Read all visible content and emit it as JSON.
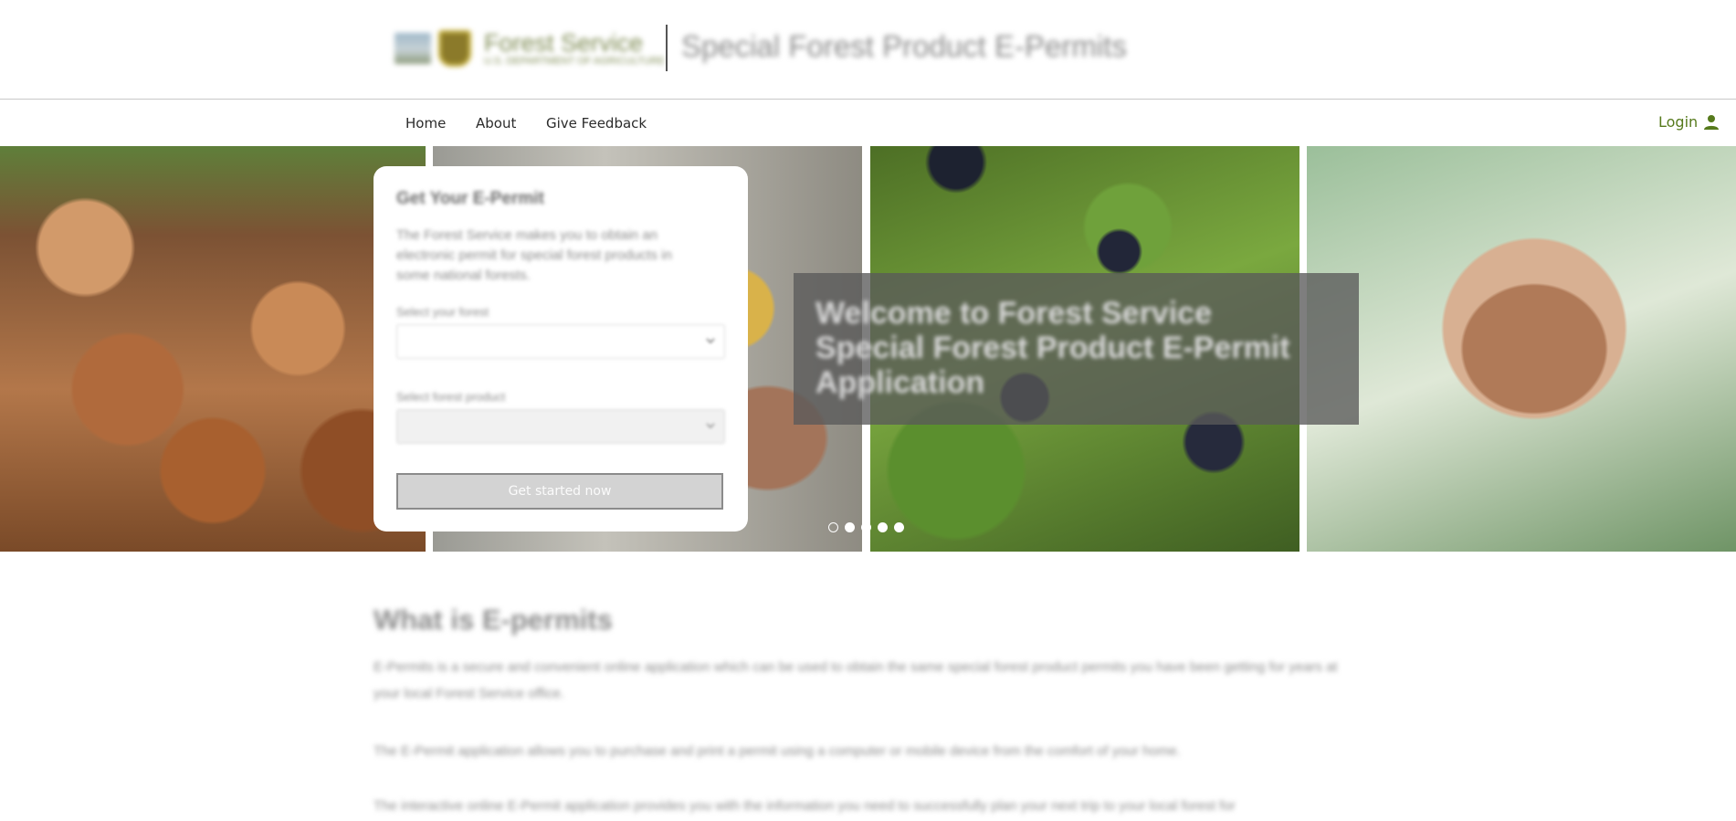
{
  "header": {
    "agency_name": "Forest Service",
    "agency_dept": "U.S. DEPARTMENT OF AGRICULTURE",
    "app_title": "Special Forest Product E-Permits"
  },
  "nav": {
    "items": [
      {
        "label": "Home"
      },
      {
        "label": "About"
      },
      {
        "label": "Give Feedback"
      }
    ],
    "login_label": "Login"
  },
  "hero": {
    "welcome": "Welcome to Forest Service Special Forest Product E-Permit Application",
    "slide_count": 5,
    "active_slide": 1
  },
  "card": {
    "title": "Get Your E-Permit",
    "description": "The Forest Service makes you to obtain an electronic permit for special forest products in some national forests.",
    "forest_label": "Select your forest",
    "product_label": "Select forest product",
    "button_label": "Get started now"
  },
  "content": {
    "title": "What is E-permits",
    "paragraphs": [
      "E-Permits is a secure and convenient online application which can be used to obtain the same special forest product permits you have been getting for years at your local Forest Service office.",
      "The E-Permit application allows you to purchase and print a permit using a computer or mobile device from the comfort of your home.",
      "The interactive online E-Permit application provides you with the information you need to successfully plan your next trip to your local forest for"
    ]
  },
  "colors": {
    "login_green": "#567a1c",
    "overlay": "#5a5a5a",
    "button_bg": "#d3d3d3"
  },
  "icons": {
    "login": "person-icon",
    "select": "chevron-down-icon"
  }
}
